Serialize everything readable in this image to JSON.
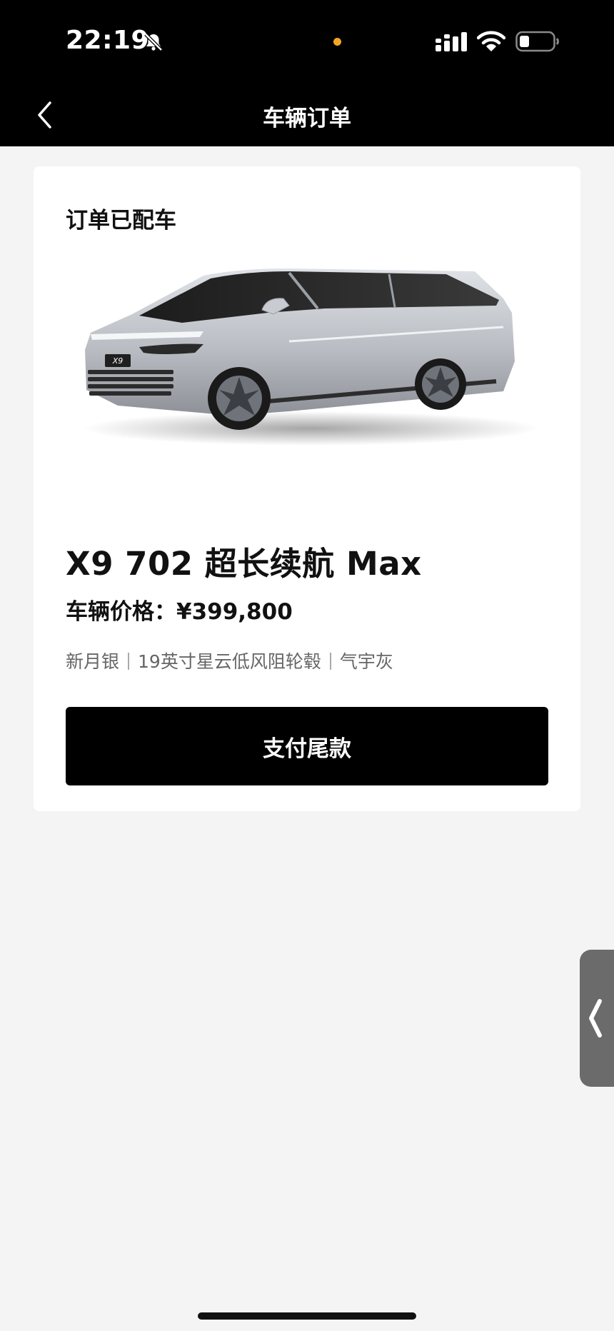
{
  "status_bar": {
    "time": "22:19",
    "icons": [
      "bell-muted-icon",
      "signal-icon",
      "wifi-icon",
      "battery-icon"
    ],
    "privacy_dot_color": "#f5a623"
  },
  "nav": {
    "title": "车辆订单",
    "back_icon": "chevron-left-icon"
  },
  "order": {
    "status": "订单已配车",
    "model": "X9 702 超长续航 Max",
    "price": "车辆价格：¥399,800",
    "options": [
      "新月银",
      "19英寸星云低风阻轮毂",
      "气宇灰"
    ],
    "badge": "X9",
    "pay_button": "支付尾款"
  },
  "side_handle": {
    "icon": "chevron-left-icon"
  }
}
